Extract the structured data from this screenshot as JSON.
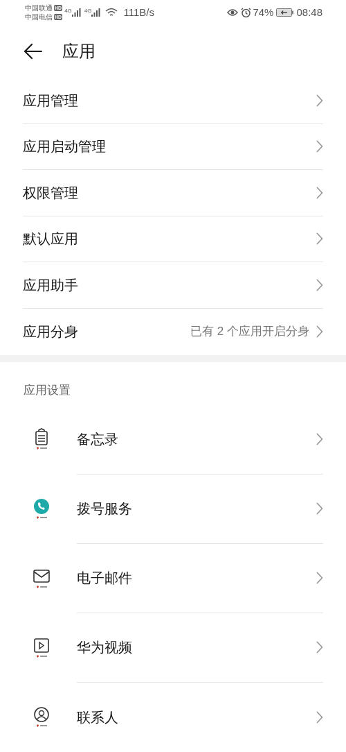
{
  "status_bar": {
    "carriers": [
      {
        "name": "中国联通",
        "badge": "HD",
        "network": "4G"
      },
      {
        "name": "中国电信",
        "badge": "HD",
        "network": "4G"
      }
    ],
    "speed": "111B/s",
    "battery": "74%",
    "time": "08:48"
  },
  "header": {
    "title": "应用"
  },
  "menu": [
    {
      "label": "应用管理"
    },
    {
      "label": "应用启动管理"
    },
    {
      "label": "权限管理"
    },
    {
      "label": "默认应用"
    },
    {
      "label": "应用助手"
    },
    {
      "label": "应用分身",
      "value": "已有 2 个应用开启分身"
    }
  ],
  "section": {
    "title": "应用设置",
    "apps": [
      {
        "kind": "notes",
        "label": "备忘录"
      },
      {
        "kind": "phone",
        "label": "拨号服务"
      },
      {
        "kind": "mail",
        "label": "电子邮件"
      },
      {
        "kind": "video",
        "label": "华为视频"
      },
      {
        "kind": "contacts",
        "label": "联系人"
      }
    ]
  }
}
